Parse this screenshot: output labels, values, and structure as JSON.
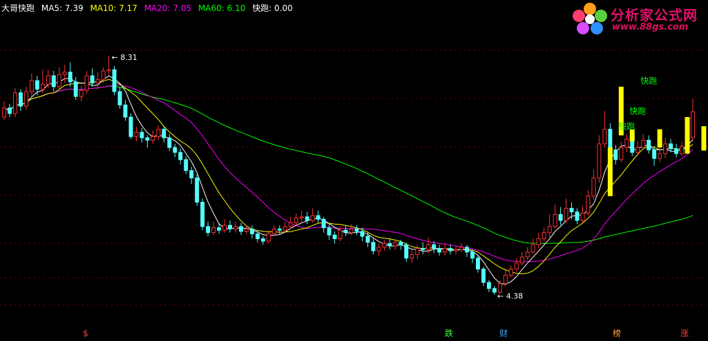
{
  "legend": {
    "indicator": "大哥快跑",
    "ma5": "MA5: 7.39",
    "ma10": "MA10: 7.17",
    "ma20": "MA20: 7.05",
    "ma60": "MA60: 6.10",
    "signal": "快跑: 0.00"
  },
  "logo": {
    "title": "分析家公式网",
    "url": "www.88gs.com"
  },
  "colors": {
    "background": "#000000",
    "up_candle": "#ff3232",
    "down_candle": "#54ffff",
    "ma5": "#ffffff",
    "ma10": "#ffff00",
    "ma20": "#ff00ff",
    "ma60": "#00ff00",
    "signal_bar": "#ffff00",
    "signal_text": "#00ff00",
    "grid": "#8b0000"
  },
  "chart_data": {
    "type": "candlestick",
    "title": "大哥快跑",
    "ylim": [
      3.9,
      9.0
    ],
    "grid": true,
    "high_label": "8.31",
    "low_label": "4.38",
    "x_markers": [
      "$",
      "跌",
      "财",
      "榜",
      "涨"
    ],
    "signal_label": "快跑",
    "signal_label_count": 3,
    "candles": [
      [
        7.3,
        7.45,
        7.56,
        7.25
      ],
      [
        7.45,
        7.36,
        7.52,
        7.3
      ],
      [
        7.36,
        7.7,
        7.78,
        7.3
      ],
      [
        7.7,
        7.48,
        7.76,
        7.4
      ],
      [
        7.48,
        7.72,
        7.8,
        7.42
      ],
      [
        7.72,
        7.9,
        8.02,
        7.64
      ],
      [
        7.9,
        7.76,
        7.98,
        7.66
      ],
      [
        7.76,
        7.84,
        8.08,
        7.7
      ],
      [
        7.84,
        7.98,
        8.08,
        7.78
      ],
      [
        7.98,
        7.8,
        8.06,
        7.72
      ],
      [
        7.8,
        8.0,
        8.12,
        7.76
      ],
      [
        8.0,
        8.04,
        8.16,
        7.86
      ],
      [
        8.04,
        7.88,
        8.2,
        7.8
      ],
      [
        7.88,
        7.64,
        7.96,
        7.58
      ],
      [
        7.64,
        7.74,
        7.82,
        7.56
      ],
      [
        7.74,
        7.98,
        8.06,
        7.68
      ],
      [
        7.98,
        7.86,
        8.1,
        7.8
      ],
      [
        7.86,
        7.92,
        8.04,
        7.76
      ],
      [
        7.92,
        8.06,
        8.12,
        7.86
      ],
      [
        8.06,
        8.08,
        8.31,
        8.0
      ],
      [
        8.08,
        7.72,
        8.14,
        7.66
      ],
      [
        7.72,
        7.5,
        7.8,
        7.44
      ],
      [
        7.5,
        7.3,
        7.58,
        7.24
      ],
      [
        7.3,
        6.98,
        7.36,
        6.94
      ],
      [
        6.98,
        7.05,
        7.14,
        6.9
      ],
      [
        7.05,
        6.96,
        7.12,
        6.88
      ],
      [
        6.96,
        6.92,
        7.0,
        6.8
      ],
      [
        6.92,
        6.98,
        7.08,
        6.86
      ],
      [
        6.98,
        7.1,
        7.16,
        6.92
      ],
      [
        7.1,
        6.96,
        7.14,
        6.88
      ],
      [
        6.96,
        6.8,
        7.02,
        6.74
      ],
      [
        6.8,
        6.72,
        6.86,
        6.64
      ],
      [
        6.72,
        6.6,
        6.78,
        6.52
      ],
      [
        6.6,
        6.42,
        6.66,
        6.36
      ],
      [
        6.42,
        6.3,
        6.48,
        6.2
      ],
      [
        6.3,
        5.9,
        6.36,
        5.84
      ],
      [
        5.9,
        5.5,
        5.96,
        5.44
      ],
      [
        5.5,
        5.4,
        5.58,
        5.34
      ],
      [
        5.4,
        5.48,
        5.58,
        5.36
      ],
      [
        5.48,
        5.44,
        5.56,
        5.38
      ],
      [
        5.44,
        5.52,
        5.62,
        5.4
      ],
      [
        5.52,
        5.46,
        5.6,
        5.4
      ],
      [
        5.46,
        5.5,
        5.58,
        5.4
      ],
      [
        5.5,
        5.42,
        5.56,
        5.36
      ],
      [
        5.42,
        5.46,
        5.52,
        5.38
      ],
      [
        5.46,
        5.38,
        5.52,
        5.3
      ],
      [
        5.38,
        5.3,
        5.44,
        5.24
      ],
      [
        5.3,
        5.26,
        5.34,
        5.2
      ],
      [
        5.26,
        5.38,
        5.44,
        5.22
      ],
      [
        5.38,
        5.46,
        5.52,
        5.34
      ],
      [
        5.46,
        5.44,
        5.52,
        5.38
      ],
      [
        5.44,
        5.5,
        5.58,
        5.4
      ],
      [
        5.5,
        5.56,
        5.66,
        5.46
      ],
      [
        5.56,
        5.64,
        5.72,
        5.52
      ],
      [
        5.64,
        5.66,
        5.76,
        5.56
      ],
      [
        5.66,
        5.6,
        5.74,
        5.54
      ],
      [
        5.6,
        5.68,
        5.8,
        5.56
      ],
      [
        5.68,
        5.62,
        5.76,
        5.56
      ],
      [
        5.62,
        5.48,
        5.66,
        5.4
      ],
      [
        5.48,
        5.36,
        5.54,
        5.28
      ],
      [
        5.36,
        5.3,
        5.42,
        5.22
      ],
      [
        5.3,
        5.44,
        5.5,
        5.26
      ],
      [
        5.44,
        5.4,
        5.52,
        5.34
      ],
      [
        5.4,
        5.46,
        5.54,
        5.36
      ],
      [
        5.46,
        5.42,
        5.52,
        5.36
      ],
      [
        5.42,
        5.34,
        5.48,
        5.26
      ],
      [
        5.34,
        5.24,
        5.4,
        5.16
      ],
      [
        5.24,
        5.1,
        5.3,
        5.04
      ],
      [
        5.1,
        5.16,
        5.22,
        5.02
      ],
      [
        5.16,
        5.22,
        5.28,
        5.1
      ],
      [
        5.22,
        5.18,
        5.3,
        5.12
      ],
      [
        5.18,
        5.24,
        5.3,
        5.12
      ],
      [
        5.24,
        5.2,
        5.28,
        5.12
      ],
      [
        5.2,
        4.98,
        5.24,
        4.92
      ],
      [
        4.98,
        5.04,
        5.12,
        4.9
      ],
      [
        5.04,
        5.14,
        5.2,
        4.96
      ],
      [
        5.14,
        5.12,
        5.24,
        5.04
      ],
      [
        5.12,
        5.2,
        5.32,
        5.06
      ],
      [
        5.2,
        5.14,
        5.26,
        5.06
      ],
      [
        5.14,
        5.08,
        5.2,
        5.02
      ],
      [
        5.08,
        5.14,
        5.22,
        5.02
      ],
      [
        5.14,
        5.1,
        5.2,
        5.04
      ],
      [
        5.1,
        5.12,
        5.18,
        5.04
      ],
      [
        5.12,
        5.16,
        5.22,
        5.08
      ],
      [
        5.16,
        5.08,
        5.2,
        5.0
      ],
      [
        5.08,
        4.98,
        5.12,
        4.9
      ],
      [
        4.98,
        4.8,
        5.02,
        4.74
      ],
      [
        4.8,
        4.58,
        4.84,
        4.52
      ],
      [
        4.58,
        4.48,
        4.62,
        4.42
      ],
      [
        4.48,
        4.42,
        4.52,
        4.38
      ],
      [
        4.42,
        4.56,
        4.62,
        4.4
      ],
      [
        4.56,
        4.7,
        4.78,
        4.52
      ],
      [
        4.7,
        4.8,
        4.86,
        4.66
      ],
      [
        4.8,
        4.9,
        4.98,
        4.76
      ],
      [
        4.9,
        5.0,
        5.08,
        4.86
      ],
      [
        5.0,
        5.08,
        5.16,
        4.94
      ],
      [
        5.08,
        5.2,
        5.3,
        5.04
      ],
      [
        5.2,
        5.3,
        5.4,
        5.14
      ],
      [
        5.3,
        5.4,
        5.48,
        5.24
      ],
      [
        5.4,
        5.5,
        5.7,
        5.32
      ],
      [
        5.5,
        5.7,
        5.86,
        5.46
      ],
      [
        5.7,
        5.6,
        5.82,
        5.52
      ],
      [
        5.6,
        5.8,
        5.96,
        5.56
      ],
      [
        5.8,
        5.74,
        5.9,
        5.62
      ],
      [
        5.74,
        5.6,
        5.8,
        5.54
      ],
      [
        5.6,
        5.72,
        5.84,
        5.56
      ],
      [
        5.72,
        6.0,
        6.1,
        5.68
      ],
      [
        6.0,
        6.3,
        6.44,
        5.94
      ],
      [
        6.3,
        6.86,
        7.0,
        6.22
      ],
      [
        6.86,
        7.1,
        7.4,
        6.8
      ],
      [
        7.1,
        6.76,
        7.2,
        6.7
      ],
      [
        6.76,
        6.6,
        6.84,
        6.52
      ],
      [
        6.6,
        6.8,
        6.9,
        6.56
      ],
      [
        6.8,
        6.94,
        7.02,
        6.72
      ],
      [
        6.94,
        6.72,
        7.04,
        6.66
      ],
      [
        6.72,
        6.8,
        6.9,
        6.66
      ],
      [
        6.8,
        6.92,
        7.02,
        6.76
      ],
      [
        6.92,
        6.76,
        7.0,
        6.7
      ],
      [
        6.76,
        6.62,
        6.82,
        6.5
      ],
      [
        6.62,
        6.7,
        6.8,
        6.56
      ],
      [
        6.7,
        6.86,
        6.96,
        6.62
      ],
      [
        6.86,
        6.78,
        6.94,
        6.72
      ],
      [
        6.78,
        6.7,
        6.86,
        6.64
      ],
      [
        6.7,
        6.82,
        6.9,
        6.66
      ],
      [
        6.82,
        6.96,
        7.14,
        6.76
      ],
      [
        6.96,
        7.39,
        7.6,
        6.9
      ]
    ],
    "signal_bars": [
      [
        110,
        6.0,
        6.8
      ],
      [
        112,
        7.0,
        7.8
      ],
      [
        114,
        6.9,
        7.1
      ],
      [
        119,
        6.8,
        7.1
      ],
      [
        124,
        6.7,
        7.3
      ],
      [
        127,
        6.75,
        7.15
      ],
      [
        130,
        6.9,
        7.5
      ]
    ]
  }
}
